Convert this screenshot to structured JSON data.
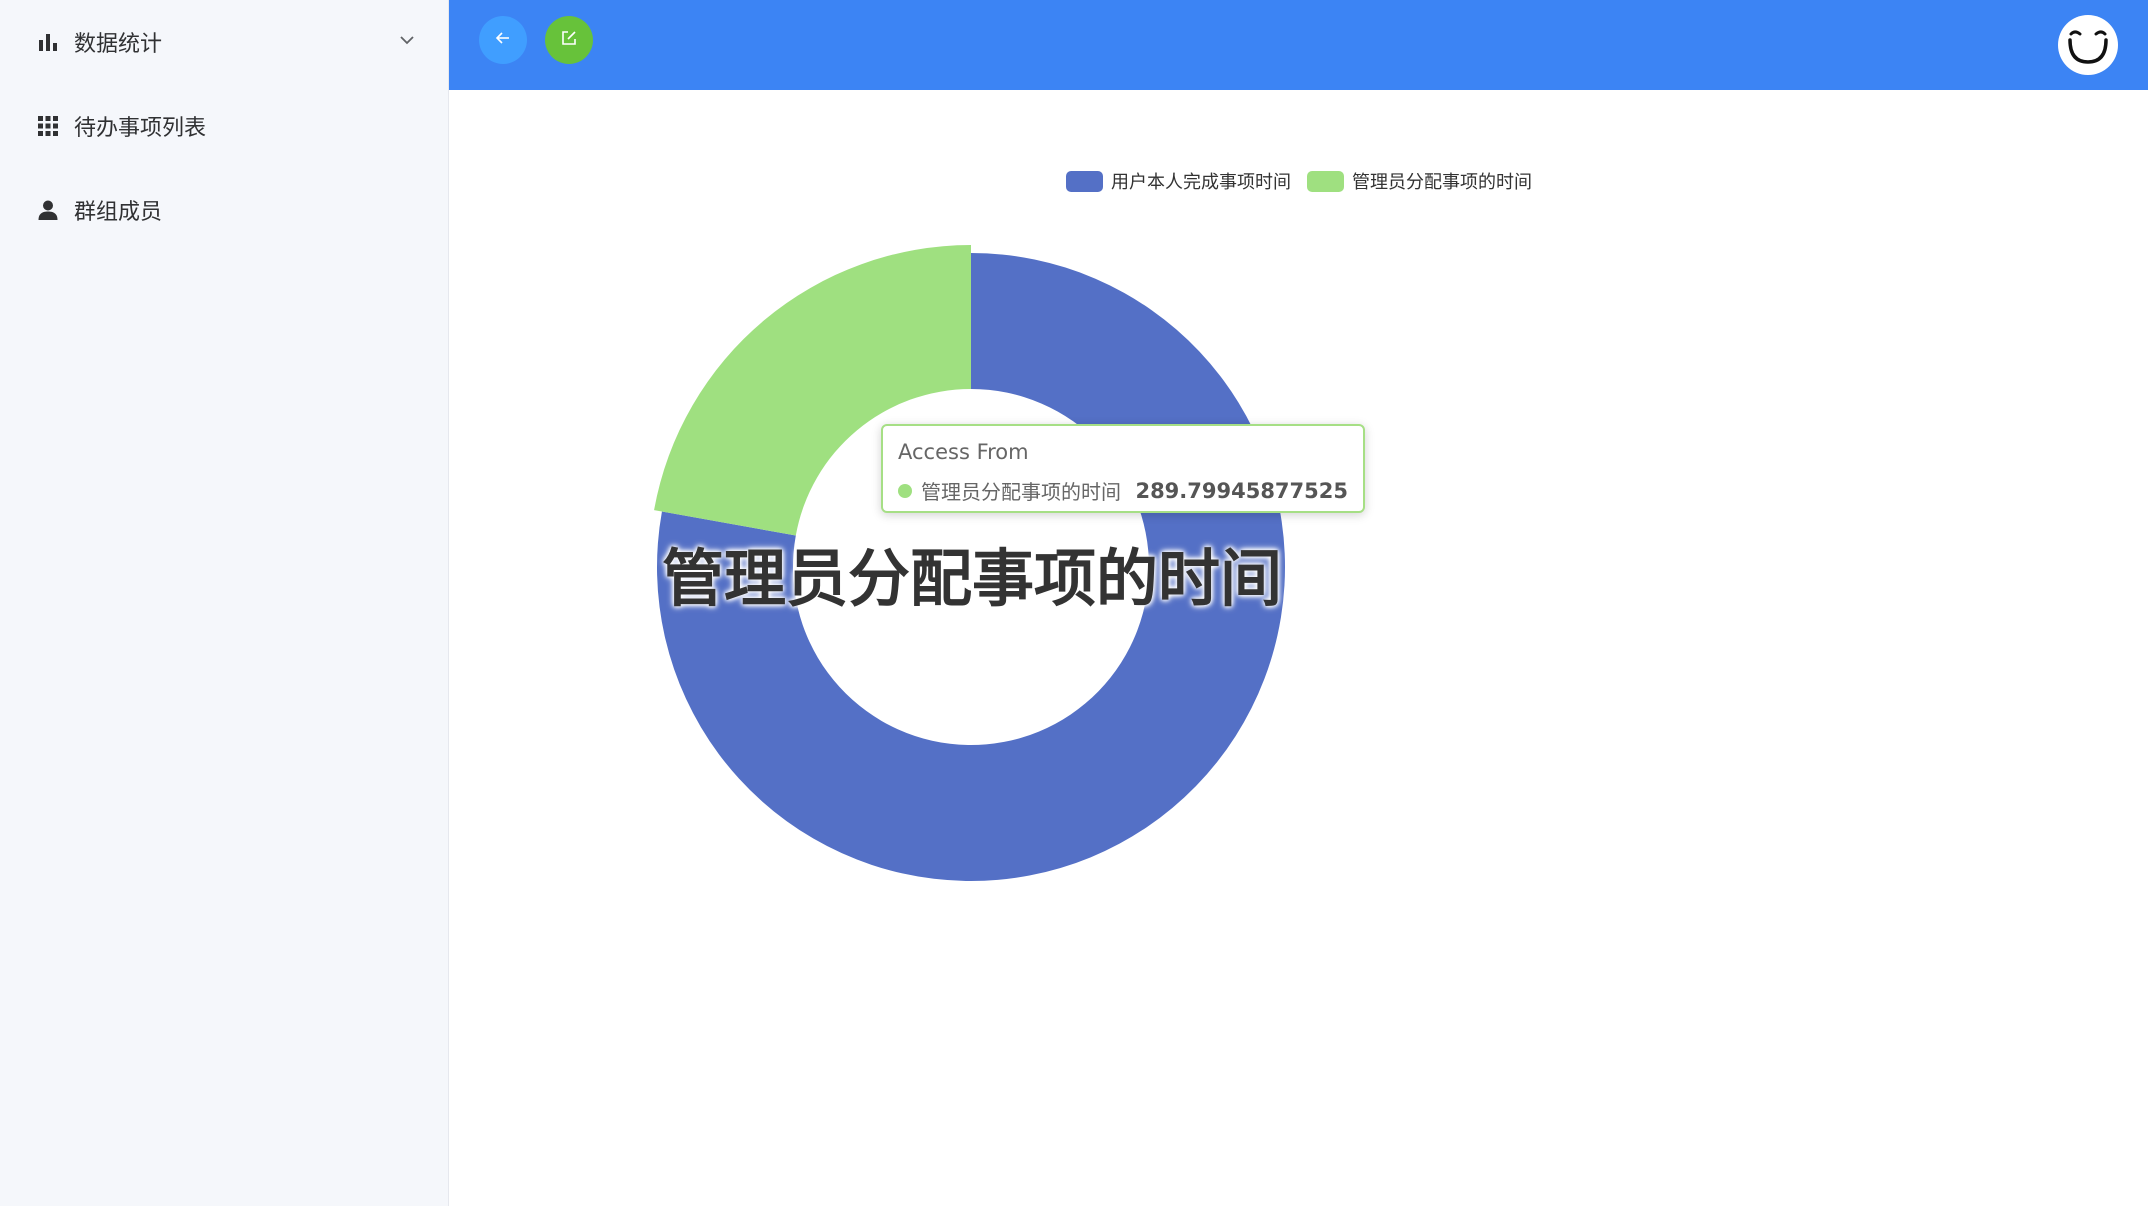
{
  "sidebar": {
    "items": [
      {
        "label": "数据统计",
        "icon": "bar-chart-icon",
        "has_submenu": true
      },
      {
        "label": "待办事项列表",
        "icon": "grid-icon"
      },
      {
        "label": "群组成员",
        "icon": "user-icon"
      }
    ]
  },
  "header": {
    "back_icon": "arrow-left-icon",
    "edit_icon": "edit-icon",
    "avatar": "smiley-avatar",
    "colors": {
      "bar": "#3c84f4",
      "back": "#409eff",
      "edit": "#67c23a"
    }
  },
  "chart_data": {
    "type": "pie",
    "variant": "donut",
    "legend_position": "top",
    "series": [
      {
        "name": "用户本人完成事项时间",
        "value": 1017.3,
        "color": "#5470c6"
      },
      {
        "name": "管理员分配事项的时间",
        "value": 289.79945877525,
        "color": "#9fe080"
      }
    ],
    "highlighted": "管理员分配事项的时间",
    "center_label": "管理员分配事项的时间",
    "tooltip": {
      "title": "Access From",
      "series_name": "管理员分配事项的时间",
      "value": "289.79945877525"
    }
  }
}
